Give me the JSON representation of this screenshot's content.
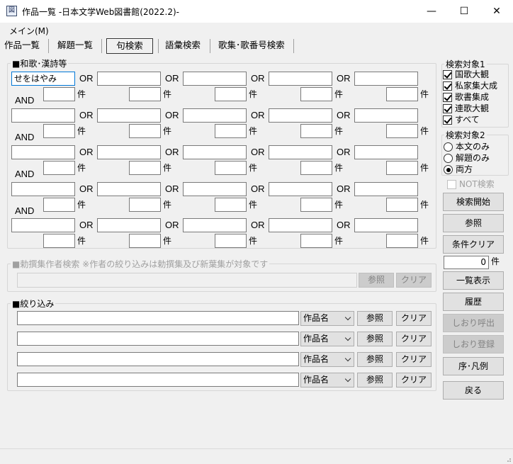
{
  "window": {
    "title": "作品一覧 -日本文学Web図書館(2022.2)-",
    "app_icon_glyph": "図",
    "minimize_glyph": "—",
    "maximize_glyph": "☐",
    "close_glyph": "✕"
  },
  "menu": {
    "main": "メイン(M)"
  },
  "tabs": [
    {
      "label": "作品一覧",
      "active": false
    },
    {
      "label": "解題一覧",
      "active": false
    },
    {
      "label": "句検索",
      "active": true
    },
    {
      "label": "語彙検索",
      "active": false
    },
    {
      "label": "歌集･歌番号検索",
      "active": false
    }
  ],
  "waka_group": {
    "label": "■和歌･漢詩等",
    "or_label": "OR",
    "and_label": "AND",
    "count_unit": "件",
    "first_term_value": "せをはやみ",
    "count_values": [
      "",
      "",
      "",
      "",
      ""
    ]
  },
  "author_group": {
    "label": "■勅撰集作者検索 ※作者の絞り込みは勅撰集及び新葉集が対象です",
    "input_value": "",
    "ref_button": "参照",
    "clear_button": "クリア"
  },
  "filter_group": {
    "label": "■絞り込み",
    "rows": [
      {
        "value": "",
        "select": "作品名"
      },
      {
        "value": "",
        "select": "作品名"
      },
      {
        "value": "",
        "select": "作品名"
      },
      {
        "value": "",
        "select": "作品名"
      }
    ],
    "ref_button": "参照",
    "clear_button": "クリア"
  },
  "target1": {
    "label": "検索対象1",
    "options": [
      {
        "label": "国歌大観",
        "checked": true
      },
      {
        "label": "私家集大成",
        "checked": true
      },
      {
        "label": "歌書集成",
        "checked": true
      },
      {
        "label": "連歌大観",
        "checked": true
      },
      {
        "label": "すべて",
        "checked": true
      }
    ]
  },
  "target2": {
    "label": "検索対象2",
    "options": [
      {
        "label": "本文のみ",
        "selected": false
      },
      {
        "label": "解題のみ",
        "selected": false
      },
      {
        "label": "両方",
        "selected": true
      }
    ]
  },
  "not_search": {
    "label": "NOT検索",
    "checked": false
  },
  "actions": {
    "search_start": "検索開始",
    "reference": "参照",
    "condition_clear": "条件クリア",
    "count_value": "0",
    "count_unit": "件",
    "list_display": "一覧表示",
    "history": "履歴",
    "bookmark_recall": "しおり呼出",
    "bookmark_register": "しおり登録",
    "preface_legend": "序･凡例",
    "back": "戻る"
  }
}
